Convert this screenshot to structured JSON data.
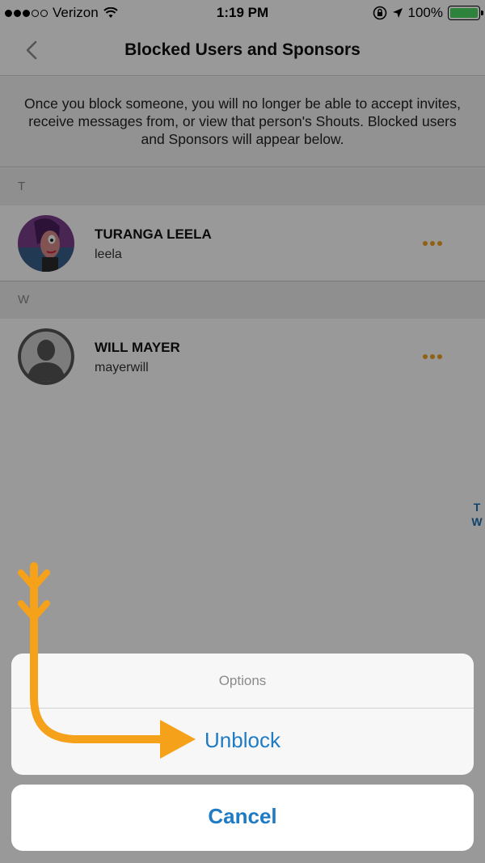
{
  "status_bar": {
    "carrier": "Verizon",
    "time": "1:19 PM",
    "battery": "100%",
    "battery_level": 1.0,
    "signal_bars": 3,
    "icons": [
      "signal-dots-icon",
      "wifi-icon",
      "orientation-lock-icon",
      "location-arrow-icon",
      "battery-icon"
    ]
  },
  "nav": {
    "title": "Blocked Users and Sponsors",
    "back_icon": "chevron-left-icon"
  },
  "info_text": "Once you block someone, you will no longer be able to accept invites, receive messages from, or view that person's Shouts. Blocked users and Sponsors will appear below.",
  "sections": [
    {
      "letter": "T",
      "users": [
        {
          "name": "TURANGA LEELA",
          "handle": "leela",
          "avatar": "cartoon-avatar"
        }
      ]
    },
    {
      "letter": "W",
      "users": [
        {
          "name": "WILL MAYER",
          "handle": "mayerwill",
          "avatar": "default-person-avatar"
        }
      ]
    }
  ],
  "index_letters": [
    "T",
    "W"
  ],
  "action_sheet": {
    "title": "Options",
    "unblock_label": "Unblock",
    "cancel_label": "Cancel"
  },
  "colors": {
    "accent_blue": "#1f7bc4",
    "more_dots_orange": "#f0a020",
    "annotation_arrow": "#f5a11a"
  }
}
